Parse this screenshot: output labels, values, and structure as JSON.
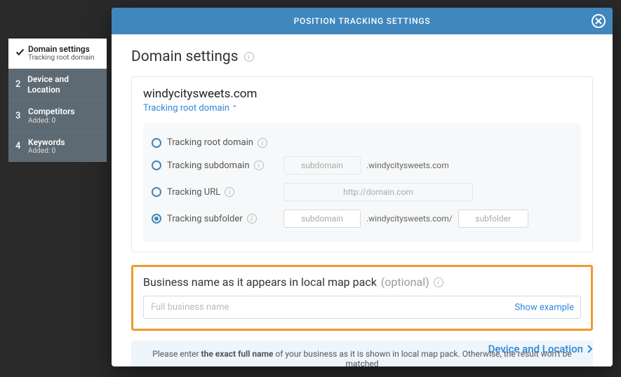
{
  "header": {
    "title": "POSITION TRACKING SETTINGS"
  },
  "sidebar": {
    "steps": [
      {
        "num": "✓",
        "title": "Domain settings",
        "sub": "Tracking root domain"
      },
      {
        "num": "2",
        "title": "Device and Location",
        "sub": ""
      },
      {
        "num": "3",
        "title": "Competitors",
        "sub": "Added: 0"
      },
      {
        "num": "4",
        "title": "Keywords",
        "sub": "Added: 0"
      }
    ]
  },
  "section": {
    "heading": "Domain settings"
  },
  "domain": {
    "name": "windycitysweets.com",
    "toggle": "Tracking root domain"
  },
  "tracking": {
    "root": "Tracking root domain",
    "sub": "Tracking subdomain",
    "sub_suffix": ".windycitysweets.com",
    "sub_placeholder": "subdomain",
    "url": "Tracking URL",
    "url_placeholder": "http://domain.com",
    "folder": "Tracking subfolder",
    "folder_sub_placeholder": "subdomain",
    "folder_suffix": ".windycitysweets.com/",
    "folder_placeholder": "subfolder"
  },
  "business": {
    "label": "Business name as it appears in local map pack",
    "optional": "(optional)",
    "placeholder": "Full business name",
    "show_example": "Show example"
  },
  "hint": {
    "prefix": "Please enter ",
    "bold": "the exact full name",
    "suffix": " of your business as it is shown in local map pack. Otherwise, the result won't be matched"
  },
  "next": {
    "label": "Device and Location"
  }
}
